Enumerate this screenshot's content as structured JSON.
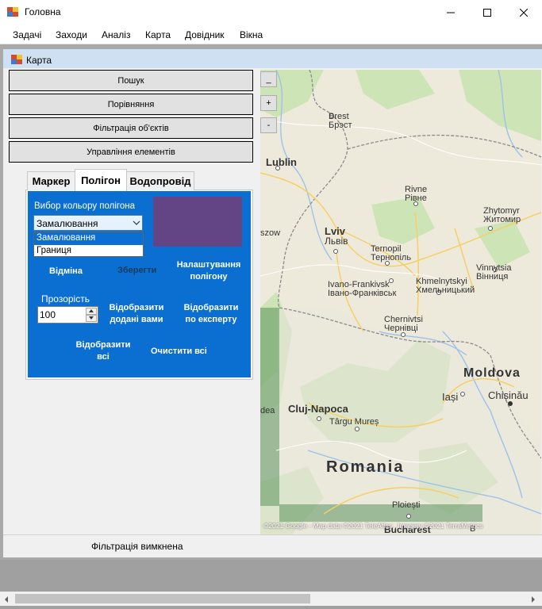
{
  "window": {
    "title": "Головна",
    "minimize_icon": "minimize-icon",
    "maximize_icon": "maximize-icon",
    "close_icon": "close-icon"
  },
  "menubar": {
    "items": [
      "Задачі",
      "Заходи",
      "Аналіз",
      "Карта",
      "Довідник",
      "Вікна"
    ]
  },
  "child_window": {
    "title": "Карта"
  },
  "left_panel": {
    "buttons": [
      "Пошук",
      "Порівняння",
      "Фільтрація об'єктів",
      "Управління елементів"
    ]
  },
  "tabs": [
    {
      "label": "Маркер",
      "selected": false
    },
    {
      "label": "Полігон",
      "selected": true
    },
    {
      "label": "Водопровід",
      "selected": false
    }
  ],
  "polygon_tab": {
    "color_label": "Вибор кольору полігона",
    "color_value": "#634485",
    "combo_value": "Замалювання",
    "combo_options": [
      "Замалювання",
      "Границя"
    ],
    "cancel_label": "Відміна",
    "save_label": "Зберегти",
    "settings_label_1": "Налаштування",
    "settings_label_2": "полігону",
    "opacity_label": "Прозорість",
    "opacity_value": "100",
    "show_added_1": "Відобразити",
    "show_added_2": "додані вами",
    "show_expert_1": "Відобразити",
    "show_expert_2": "по експерту",
    "show_all_1": "Відобразити",
    "show_all_2": "всі",
    "clear_all_label": "Очистити всі"
  },
  "zoom_controls": {
    "minimize": "_",
    "zoom_in": "+",
    "zoom_out": "-"
  },
  "map": {
    "places": [
      {
        "name": "Brest",
        "name2": "Брэст"
      },
      {
        "name": "Lublin"
      },
      {
        "name": "Rivne",
        "name2": "Рівне"
      },
      {
        "name": "Zhytomyr",
        "name2": "Житомир"
      },
      {
        "name": "szow"
      },
      {
        "name": "Lviv",
        "name2": "Львів"
      },
      {
        "name": "Ternopil",
        "name2": "Тернопіль"
      },
      {
        "name": "Vinnytsia",
        "name2": "Вінниця"
      },
      {
        "name": "Khmelnytskyi",
        "name2": "Хмельницький"
      },
      {
        "name": "Ivano-Frankivsk",
        "name2": "Івано-Франківськ"
      },
      {
        "name": "Chernivtsi",
        "name2": "Чернівці"
      },
      {
        "name": "Moldova"
      },
      {
        "name": "Iași"
      },
      {
        "name": "Chișinău"
      },
      {
        "name": "Cluj-Napoca"
      },
      {
        "name": "Târgu Mureș"
      },
      {
        "name": "dea"
      },
      {
        "name": "Romania"
      },
      {
        "name": "Ploiești"
      },
      {
        "name": "Bucharest"
      },
      {
        "name": "B"
      }
    ],
    "attribution": "©2021 Google - Map data ©2021 TeleAtlas , Imagery ©2021 TerraMetrics"
  },
  "status": {
    "text": "Фільтрація вимкнена"
  }
}
